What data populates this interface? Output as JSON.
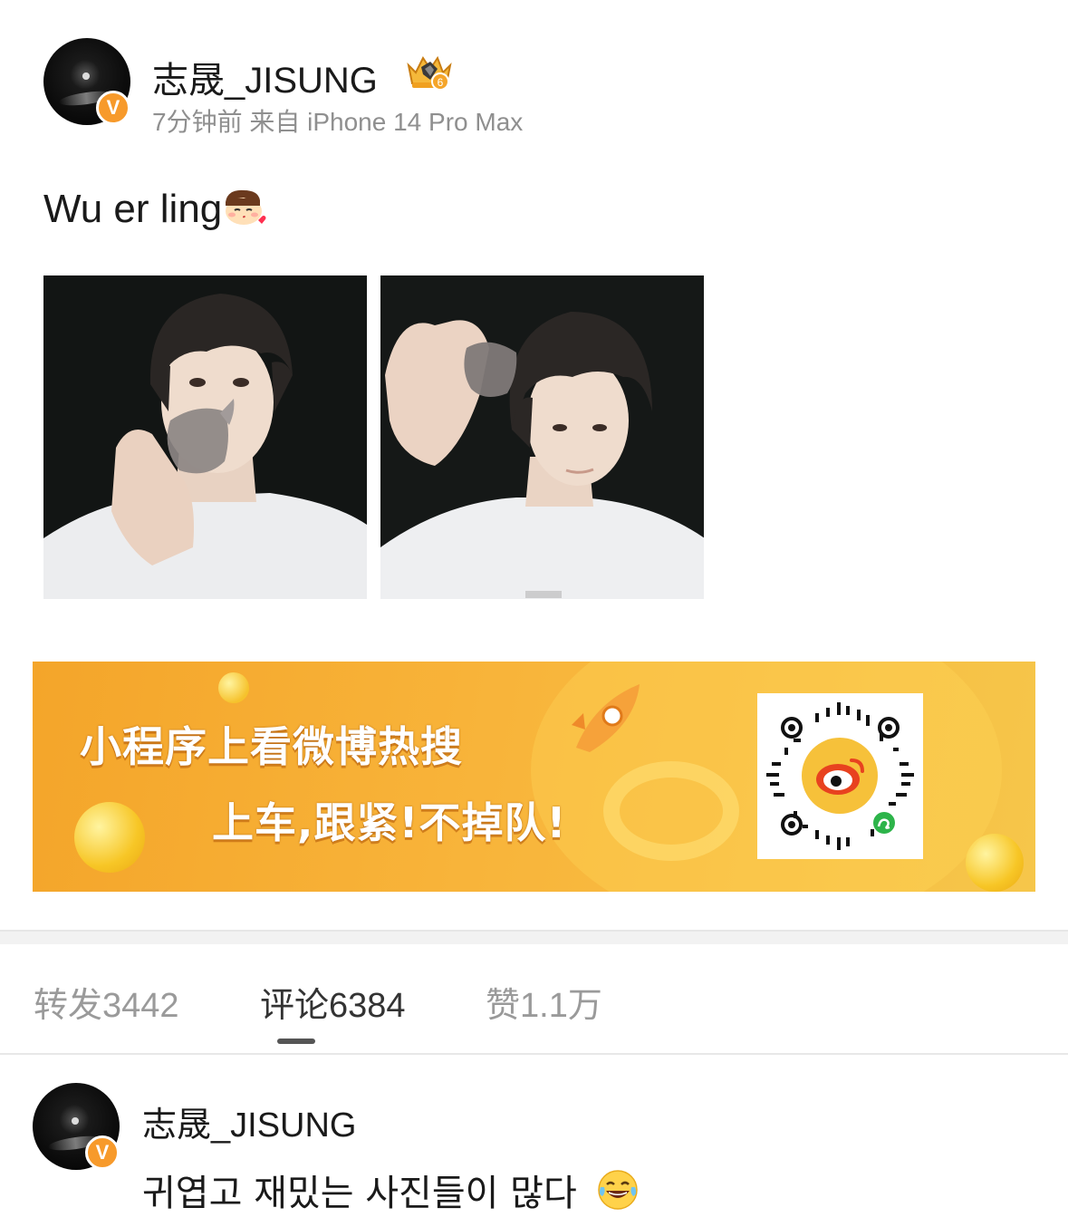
{
  "post": {
    "author": "志晟_JISUNG",
    "meta": "7分钟前 来自 iPhone 14 Pro Max",
    "badge_level": "6",
    "verified_mark": "V",
    "text": "Wu er ling",
    "text_emoji": "kiss-face-emoji",
    "photos": [
      {
        "name": "photo-1",
        "alt_icon": "selfie-photo"
      },
      {
        "name": "photo-2",
        "alt_icon": "selfie-photo"
      }
    ]
  },
  "banner": {
    "line1": "小程序上看微博热搜",
    "line2": "上车,跟紧!不掉队!",
    "colors": {
      "bg": "#f5a92e",
      "accent": "#e8421f"
    }
  },
  "tabs": [
    {
      "label": "转发3442",
      "active": false
    },
    {
      "label": "评论6384",
      "active": true
    },
    {
      "label": "赞1.1万",
      "active": false
    }
  ],
  "comment": {
    "author": "志晟_JISUNG",
    "verified_mark": "V",
    "text": "귀엽고 재밌는 사진들이 많다",
    "emoji": "laughing-tears-emoji"
  }
}
